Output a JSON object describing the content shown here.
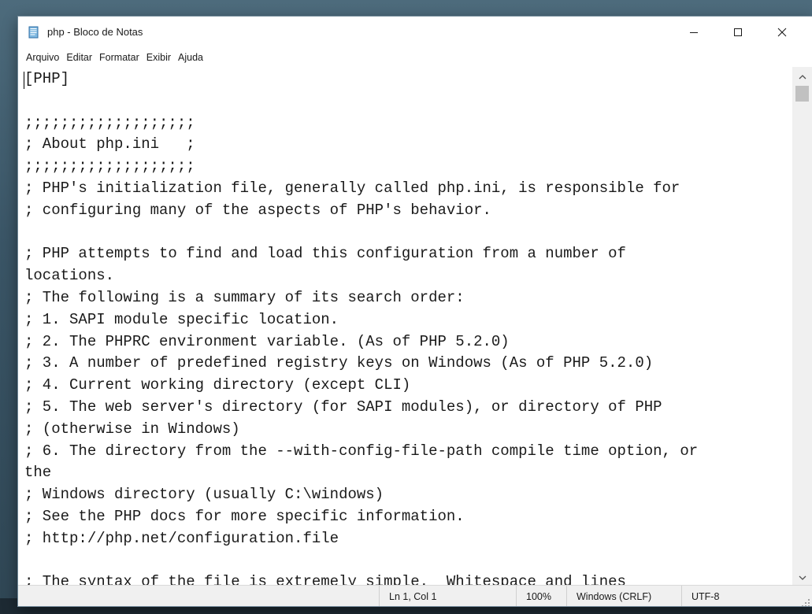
{
  "window": {
    "title": "php - Bloco de Notas",
    "app_icon": "notepad-icon"
  },
  "caption_buttons": {
    "minimize": "minimize-icon",
    "maximize": "maximize-icon",
    "close": "close-icon"
  },
  "menu": {
    "items": [
      "Arquivo",
      "Editar",
      "Formatar",
      "Exibir",
      "Ajuda"
    ]
  },
  "editor": {
    "lines": [
      "[PHP]",
      "",
      ";;;;;;;;;;;;;;;;;;;",
      "; About php.ini   ;",
      ";;;;;;;;;;;;;;;;;;;",
      "; PHP's initialization file, generally called php.ini, is responsible for",
      "; configuring many of the aspects of PHP's behavior.",
      "",
      "; PHP attempts to find and load this configuration from a number of",
      "locations.",
      "; The following is a summary of its search order:",
      "; 1. SAPI module specific location.",
      "; 2. The PHPRC environment variable. (As of PHP 5.2.0)",
      "; 3. A number of predefined registry keys on Windows (As of PHP 5.2.0)",
      "; 4. Current working directory (except CLI)",
      "; 5. The web server's directory (for SAPI modules), or directory of PHP",
      "; (otherwise in Windows)",
      "; 6. The directory from the --with-config-file-path compile time option, or",
      "the",
      "; Windows directory (usually C:\\windows)",
      "; See the PHP docs for more specific information.",
      "; http://php.net/configuration.file",
      "",
      "; The syntax of the file is extremely simple.  Whitespace and lines"
    ]
  },
  "status": {
    "position": "Ln 1, Col 1",
    "zoom": "100%",
    "line_ending": "Windows (CRLF)",
    "encoding": "UTF-8"
  },
  "colors": {
    "window_bg": "#ffffff",
    "statusbar_bg": "#f0f0f0",
    "text": "#1a1a1a",
    "scroll_thumb": "#c1c1c1"
  }
}
